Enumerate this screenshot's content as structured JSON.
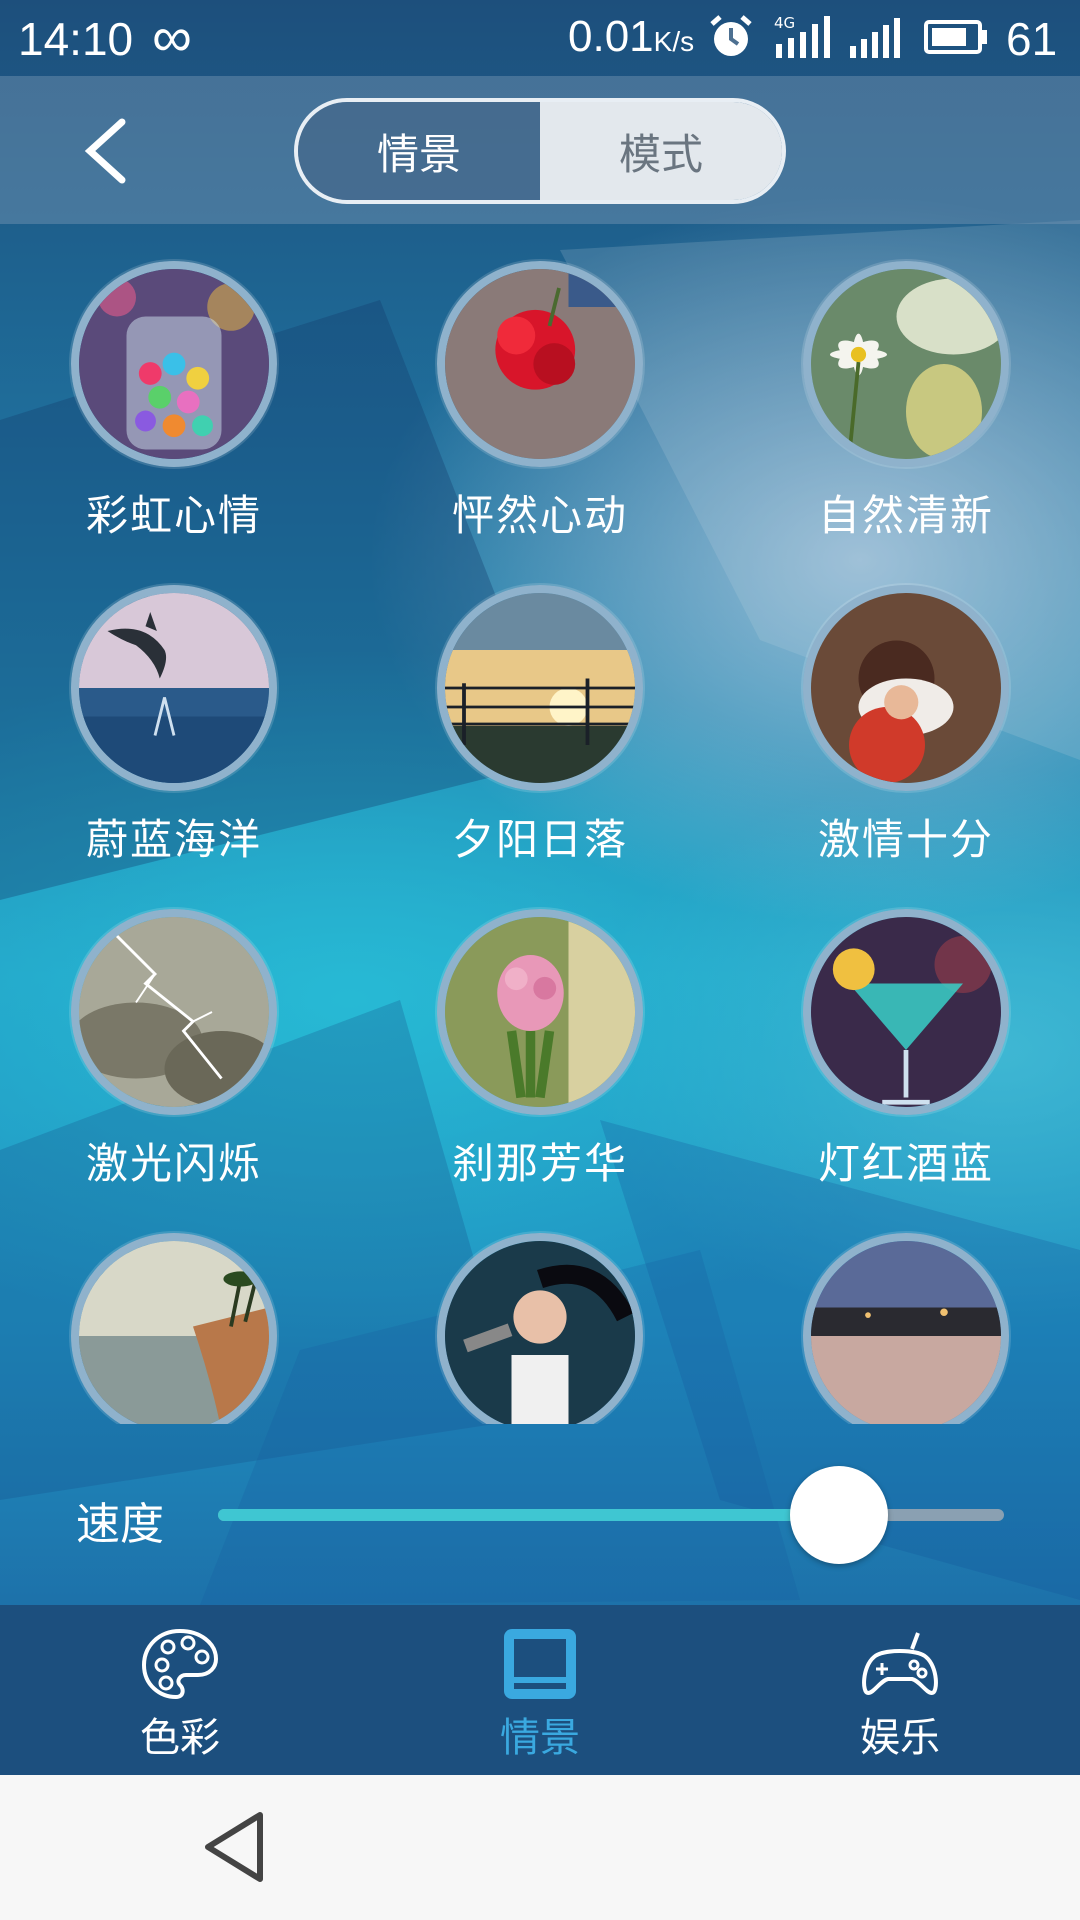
{
  "status_bar": {
    "time": "14:10",
    "infinity_symbol": "∞",
    "net_speed": "0.01",
    "net_unit": "K/s",
    "network_type": "4G",
    "battery_level": "61",
    "icons": [
      "infinity-icon",
      "alarm-icon",
      "lte-signal-icon",
      "signal-icon",
      "battery-icon"
    ]
  },
  "header": {
    "back_icon": "back-chevron-icon",
    "tabs": [
      {
        "label": "情景",
        "active": true
      },
      {
        "label": "模式",
        "active": false
      }
    ]
  },
  "scenes": [
    {
      "label": "彩虹心情",
      "image": "candy-jar"
    },
    {
      "label": "怦然心动",
      "image": "red-carnation"
    },
    {
      "label": "自然清新",
      "image": "daisy"
    },
    {
      "label": "蔚蓝海洋",
      "image": "dolphin-ocean"
    },
    {
      "label": "夕阳日落",
      "image": "sunset-fence"
    },
    {
      "label": "激情十分",
      "image": "couple-hug"
    },
    {
      "label": "激光闪烁",
      "image": "lightning"
    },
    {
      "label": "刹那芳华",
      "image": "hyacinth"
    },
    {
      "label": "灯红酒蓝",
      "image": "cocktail"
    },
    {
      "label": "",
      "image": "beach"
    },
    {
      "label": "",
      "image": "singer"
    },
    {
      "label": "",
      "image": "evening-plaza"
    }
  ],
  "speed": {
    "label": "速度",
    "value": 0.79
  },
  "bottom_nav": [
    {
      "label": "色彩",
      "icon": "palette-icon",
      "active": false
    },
    {
      "label": "情景",
      "icon": "scene-icon",
      "active": true
    },
    {
      "label": "娱乐",
      "icon": "gamepad-icon",
      "active": false
    }
  ],
  "system_nav": {
    "back_icon": "triangle-back-icon"
  },
  "colors": {
    "accent": "#3aa9e0",
    "slider_fill": "#3fc6d2",
    "nav_background": "#1c4f7e"
  }
}
